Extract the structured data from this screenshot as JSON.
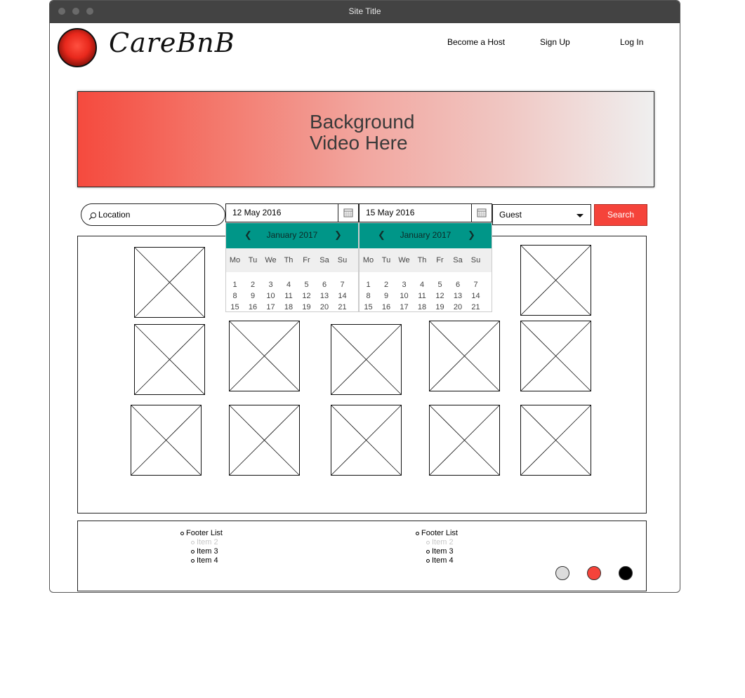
{
  "window": {
    "title": "Site Title"
  },
  "brand": {
    "name": "CareBnB"
  },
  "nav": {
    "become_host": "Become a Host",
    "sign_up": "Sign Up",
    "log_in": "Log In"
  },
  "hero": {
    "line1": "Background",
    "line2": "Video Here"
  },
  "search": {
    "location_placeholder": "Location",
    "checkin_value": "12 May 2016",
    "checkout_value": "15 May 2016",
    "guest_value": "Guest",
    "search_label": "Search"
  },
  "calendars": [
    {
      "month": "January 2017",
      "prev": "❮",
      "next": "❯"
    },
    {
      "month": "January 2017",
      "prev": "❮",
      "next": "❯"
    }
  ],
  "weekdays": [
    "Mo",
    "Tu",
    "We",
    "Th",
    "Fr",
    "Sa",
    "Su"
  ],
  "calendar_days": [
    [
      "1",
      "2",
      "3",
      "4",
      "5",
      "6",
      "7"
    ],
    [
      "8",
      "9",
      "10",
      "11",
      "12",
      "13",
      "14"
    ],
    [
      "15",
      "16",
      "17",
      "18",
      "19",
      "20",
      "21"
    ]
  ],
  "footer": {
    "lists": [
      {
        "items": [
          "Footer List",
          "Item 2",
          "Item 3",
          "Item 4"
        ]
      },
      {
        "items": [
          "Footer List",
          "Item 2",
          "Item 3",
          "Item 4"
        ]
      }
    ]
  },
  "colors": {
    "accent": "#f5433a",
    "calendar_header": "#009688",
    "disabled_item": "#c8c8c8"
  }
}
